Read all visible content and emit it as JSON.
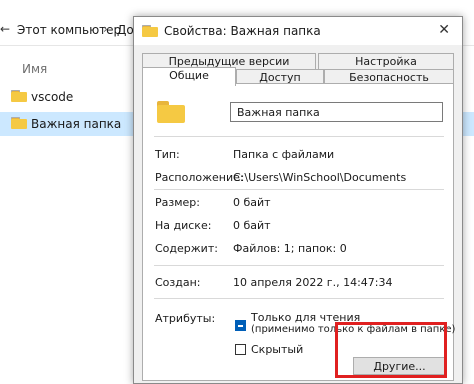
{
  "explorer": {
    "back_glyph": "←",
    "breadcrumb": "Этот компьютер",
    "breadcrumb_sep": "›",
    "breadcrumb_next": "Док",
    "right_crumb": "",
    "column_name": "Имя",
    "rows": [
      {
        "name": "vscode",
        "selected": false
      },
      {
        "name": "Важная папка",
        "selected": true
      }
    ]
  },
  "dialog": {
    "title": "Свойства: Важная папка",
    "close_glyph": "✕",
    "tabs_top": [
      "Предыдущие версии",
      "Настройка"
    ],
    "tabs_bottom": [
      "Общие",
      "Доступ",
      "Безопасность"
    ],
    "active_tab": "Общие",
    "folder_name": "Важная папка",
    "fields": [
      {
        "label": "Тип:",
        "value": "Папка с файлами"
      },
      {
        "label": "Расположение:",
        "value": "C:\\Users\\WinSchool\\Documents"
      },
      {
        "label": "Размер:",
        "value": "0 байт"
      },
      {
        "label": "На диске:",
        "value": "0 байт"
      },
      {
        "label": "Содержит:",
        "value": "Файлов: 1; папок: 0"
      }
    ],
    "created_label": "Создан:",
    "created_value": "10 апреля 2022 г., 14:47:34",
    "attributes_label": "Атрибуты:",
    "readonly_label": "Только для чтения",
    "readonly_note": "(применимо только к файлам в папке)",
    "hidden_label": "Скрытый",
    "other_button": "Другие..."
  },
  "colors": {
    "accent": "#005fb8",
    "highlight": "#e02020",
    "selection": "#cce8ff"
  }
}
